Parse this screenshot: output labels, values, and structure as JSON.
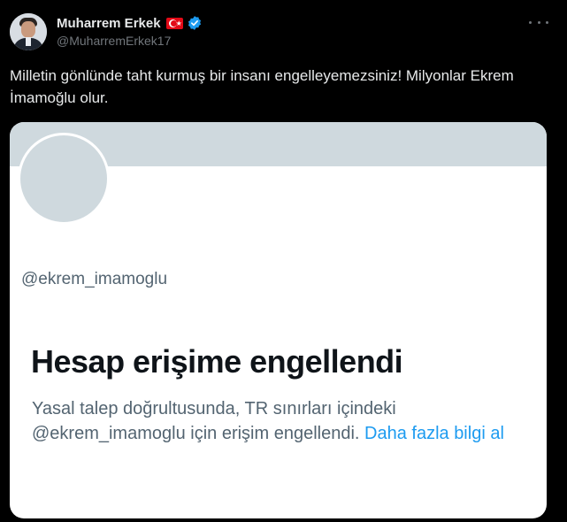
{
  "author": {
    "name": "Muharrem Erkek",
    "handle": "@MuharremErkek17",
    "flag_icon": "turkey-flag-icon",
    "verified_icon": "verified-badge-icon",
    "verified_color": "#1d9bf0"
  },
  "more_icon": "more-options-icon",
  "tweet": {
    "text": "Milletin gönlünde taht kurmuş bir insanı engelleyemezsiniz! Milyonlar Ekrem İmamoğlu olur."
  },
  "card": {
    "handle": "@ekrem_imamoglu",
    "title": "Hesap erişime engellendi",
    "description": "Yasal talep doğrultusunda, TR sınırları içindeki @ekrem_imamoglu için erişim engellendi.",
    "link_text": "Daha fazla bilgi al",
    "link_color": "#1d9bf0"
  },
  "colors": {
    "background": "#000000",
    "text": "#e7e9ea",
    "secondary_text": "#71767b",
    "card_background": "#ffffff",
    "card_placeholder": "#cfd9de"
  }
}
